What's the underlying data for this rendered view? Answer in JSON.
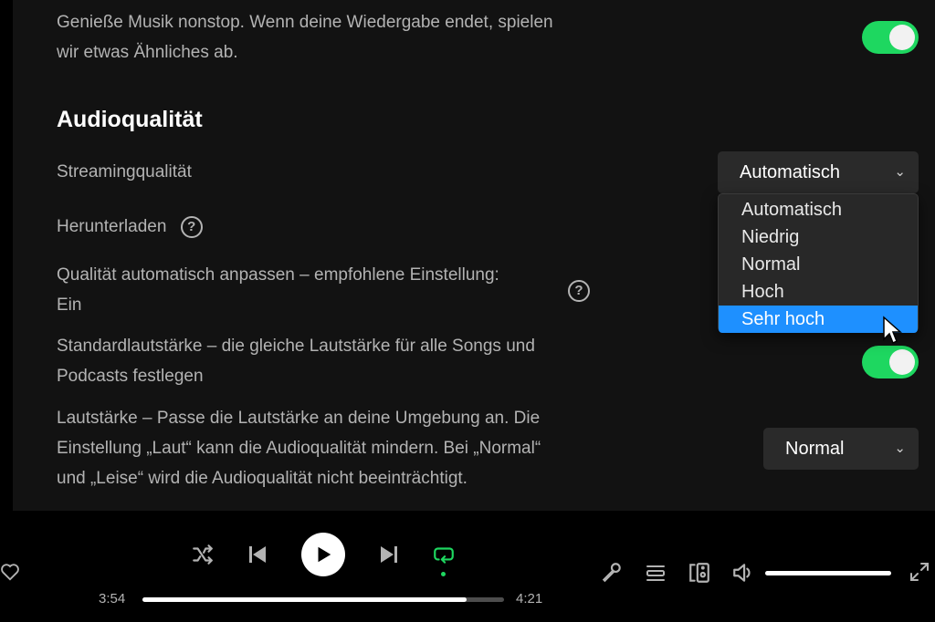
{
  "settings": {
    "autoplay_text_line1": "Genieße Musik nonstop. Wenn deine Wiedergabe endet, spielen",
    "autoplay_text_line2": "wir etwas Ähnliches ab.",
    "audio_section_title": "Audioqualität",
    "streaming_label": "Streamingqualität",
    "streaming_value": "Automatisch",
    "streaming_options": [
      "Automatisch",
      "Niedrig",
      "Normal",
      "Hoch",
      "Sehr hoch"
    ],
    "streaming_highlighted": "Sehr hoch",
    "download_label": "Herunterladen",
    "auto_adjust_line1": "Qualität automatisch anpassen – empfohlene Einstellung:",
    "auto_adjust_line2": "Ein",
    "normalize_line1": "Standardlautstärke – die gleiche Lautstärke für alle Songs und",
    "normalize_line2": "Podcasts festlegen",
    "loudness_line1": "Lautstärke – Passe die Lautstärke an deine Umgebung an. Die",
    "loudness_line2": "Einstellung „Laut“ kann die Audioqualität mindern. Bei „Normal“",
    "loudness_line3": "und „Leise“ wird die Audioqualität nicht beeinträchtigt.",
    "loudness_value": "Normal",
    "help_glyph": "?",
    "accent_color": "#1ed760",
    "highlight_color": "#1e90ff"
  },
  "player": {
    "elapsed": "3:54",
    "duration": "4:21",
    "progress_fraction": 0.897,
    "volume_fraction": 1.0,
    "repeat_active": true
  }
}
